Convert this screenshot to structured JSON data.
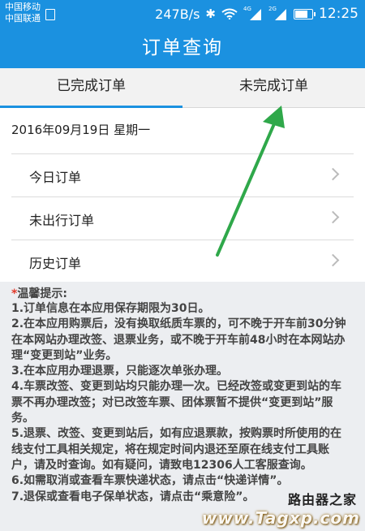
{
  "status_bar": {
    "carrier1": "中国移动",
    "carrier2": "中国联通",
    "speed": "247B/s",
    "net1": "4G",
    "net2": "2G",
    "time": "12:25",
    "battery_level": 0.7
  },
  "header": {
    "title": "订单查询"
  },
  "tabs": [
    {
      "label": "已完成订单",
      "active": true
    },
    {
      "label": "未完成订单",
      "active": false
    }
  ],
  "date_line": "2016年09月19日 星期一",
  "menu": [
    {
      "label": "今日订单"
    },
    {
      "label": "未出行订单"
    },
    {
      "label": "历史订单"
    }
  ],
  "tips": {
    "star": "*",
    "title": "温馨提示:",
    "items": [
      "1.订单信息在本应用保存期限为30日。",
      "2.在本应用购票后，没有换取纸质车票的，可不晚于开车前30分钟在本网站办理改签、退票业务，或不晚于开车前48小时在本网站办理“变更到站”业务。",
      "3.在本应用办理退票，只能逐次单张办理。",
      "4.车票改签、变更到站均只能办理一次。已经改签或变更到站的车票不再办理改签；对已改签车票、团体票暂不提供“变更到站”服务。",
      "5.退票、改签、变更到站后，如有应退票款，按购票时所使用的在线支付工具相关规定，将在规定时间内退还至原在线支付工具账户，请及时查询。如有疑问，请致电12306人工客服查询。",
      "6.如需取消或查看车票快递状态，请点击“快递详情”。",
      "7.退保或查看电子保单状态，请点击“乘意险”。"
    ]
  },
  "watermark": {
    "cn": "路由器之家",
    "en": "www.Tagxp.com"
  },
  "colors": {
    "primary": "#1b91e0",
    "annotation_arrow": "#2fa84a",
    "tip_star": "#e23a2b"
  }
}
